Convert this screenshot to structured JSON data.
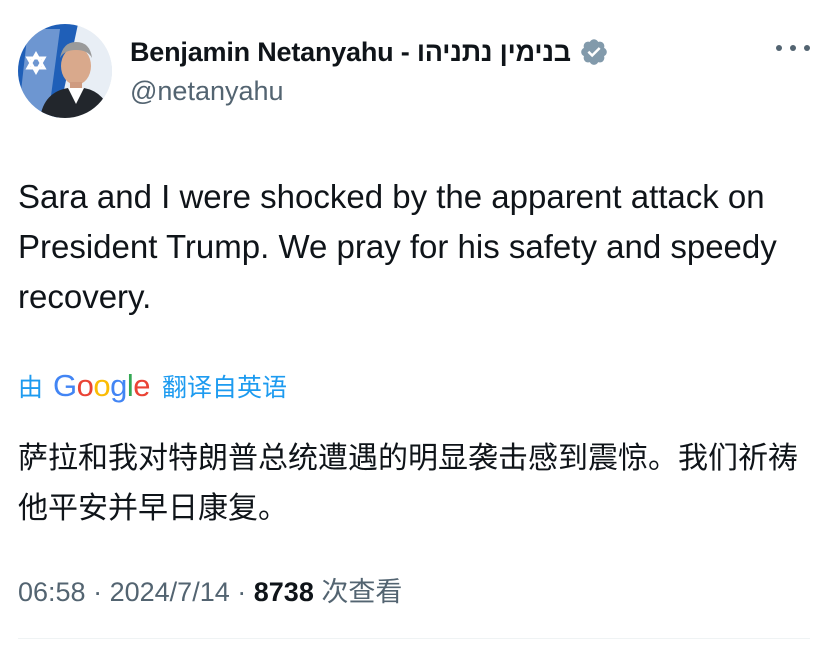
{
  "author": {
    "display_name": "Benjamin Netanyahu - בנימין נתניהו",
    "handle": "@netanyahu",
    "avatar": "profile-photo",
    "verified_icon": "verified-badge-icon"
  },
  "more_icon": "more-options-icon",
  "tweet": {
    "text": "Sara and I were shocked by the apparent attack on President Trump. We pray for his safety and speedy recovery."
  },
  "translation": {
    "prefix": "由",
    "provider_letters": [
      "G",
      "o",
      "o",
      "g",
      "l",
      "e"
    ],
    "suffix": "翻译自英语",
    "text": "萨拉和我对特朗普总统遭遇的明显袭击感到震惊。我们祈祷他平安并早日康复。"
  },
  "meta": {
    "time": "06:58",
    "separator": "·",
    "date": "2024/7/14",
    "views_count": "8738",
    "views_label": "次查看"
  },
  "colors": {
    "link": "#1d9bf0",
    "muted": "#536471",
    "verified": "#829aab"
  }
}
